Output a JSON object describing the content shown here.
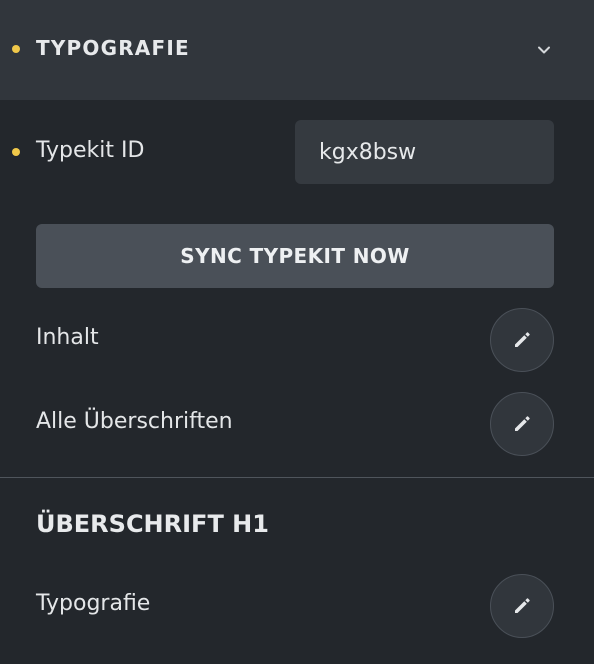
{
  "section": {
    "title": "TYPOGRAFIE",
    "expand_icon": "chevron-down-icon",
    "indicator_color": "#f0c84a"
  },
  "typekit": {
    "label": "Typekit ID",
    "value": "kgx8bsw"
  },
  "sync_button": {
    "label": "SYNC TYPEKIT NOW"
  },
  "rows": [
    {
      "label": "Inhalt",
      "icon": "pencil-icon"
    },
    {
      "label": "Alle Überschriften",
      "icon": "pencil-icon"
    }
  ],
  "h1_section": {
    "title": "ÜBERSCHRIFT H1",
    "rows": [
      {
        "label": "Typografie",
        "icon": "pencil-icon"
      }
    ]
  }
}
